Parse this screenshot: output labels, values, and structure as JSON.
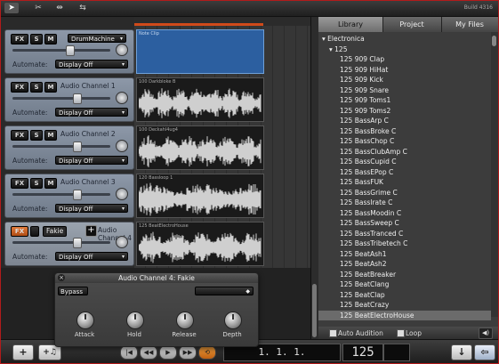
{
  "toolbar": {
    "tools": [
      "pointer-tool-icon",
      "scissors-tool-icon",
      "split-tool-icon",
      "merge-tool-icon"
    ],
    "build_text": "Build 4316"
  },
  "tracks": [
    {
      "name": "DrumMachine",
      "fx": "FX",
      "solo": "S",
      "mute": "M",
      "automate_label": "Automate:",
      "automate_value": "Display Off",
      "volume": 0.55
    },
    {
      "name": "Audio Channel 1",
      "fx": "FX",
      "solo": "S",
      "mute": "M",
      "automate_label": "Automate:",
      "automate_value": "Display Off",
      "volume": 0.6
    },
    {
      "name": "Audio Channel 2",
      "fx": "FX",
      "solo": "S",
      "mute": "M",
      "automate_label": "Automate:",
      "automate_value": "Display Off",
      "volume": 0.6
    },
    {
      "name": "Audio Channel 3",
      "fx": "FX",
      "solo": "S",
      "mute": "M",
      "automate_label": "Automate:",
      "automate_value": "Display Off",
      "volume": 0.6
    },
    {
      "name": "Fakie",
      "fx": "FX",
      "solo": "S",
      "mute": "M",
      "automate_label": "Automate:",
      "automate_value": "Display Off",
      "volume": 0.6,
      "hidden_label": "Audio Channel 4"
    }
  ],
  "clips": [
    {
      "label": "Note Clip",
      "color": "#2c5fa0"
    },
    {
      "label": "100 Darkbloke B",
      "color": "#1a1a1a"
    },
    {
      "label": "100 Deckahl4ug4",
      "color": "#1a1a1a"
    },
    {
      "label": "120 Bassloop 1",
      "color": "#1a1a1a"
    },
    {
      "label": "125 BeatElectroHouse",
      "color": "#1a1a1a"
    }
  ],
  "library": {
    "tabs": [
      "Library",
      "Project",
      "My Files"
    ],
    "active_tab": "Library",
    "items": [
      {
        "label": "▾ Electronica",
        "indent": 4
      },
      {
        "label": "▾ 125",
        "indent": 12
      },
      {
        "label": "125 909 Clap",
        "indent": 24
      },
      {
        "label": "125 909 HiHat",
        "indent": 24
      },
      {
        "label": "125 909 Kick",
        "indent": 24
      },
      {
        "label": "125 909 Snare",
        "indent": 24
      },
      {
        "label": "125 909 Toms1",
        "indent": 24
      },
      {
        "label": "125 909 Toms2",
        "indent": 24
      },
      {
        "label": "125 BassArp C",
        "indent": 24
      },
      {
        "label": "125 BassBroke C",
        "indent": 24
      },
      {
        "label": "125 BassChop C",
        "indent": 24
      },
      {
        "label": "125 BassClubAmp C",
        "indent": 24
      },
      {
        "label": "125 BassCupid C",
        "indent": 24
      },
      {
        "label": "125 BassEPop C",
        "indent": 24
      },
      {
        "label": "125 BassFUK",
        "indent": 24
      },
      {
        "label": "125 BassGrime C",
        "indent": 24
      },
      {
        "label": "125 BassIrate C",
        "indent": 24
      },
      {
        "label": "125 BassMoodin C",
        "indent": 24
      },
      {
        "label": "125 BassSweep C",
        "indent": 24
      },
      {
        "label": "125 BassTranced C",
        "indent": 24
      },
      {
        "label": "125 BassTribetech C",
        "indent": 24
      },
      {
        "label": "125 BeatAsh1",
        "indent": 24
      },
      {
        "label": "125 BeatAsh2",
        "indent": 24
      },
      {
        "label": "125 BeatBreaker",
        "indent": 24
      },
      {
        "label": "125 BeatClang",
        "indent": 24
      },
      {
        "label": "125 BeatClap",
        "indent": 24
      },
      {
        "label": "125 BeatCrazy",
        "indent": 24
      },
      {
        "label": "125 BeatElectroHouse",
        "indent": 24,
        "selected": true
      }
    ],
    "auto_audition": "Auto Audition",
    "loop": "Loop"
  },
  "transport": {
    "add_track": "+",
    "add_audio": "+♫",
    "position": "1. 1. 1.",
    "tempo": "125"
  },
  "plugin": {
    "title": "Audio Channel 4: Fakie",
    "close": "×",
    "bypass": "Bypass",
    "knobs": [
      "Attack",
      "Hold",
      "Release",
      "Depth"
    ]
  }
}
